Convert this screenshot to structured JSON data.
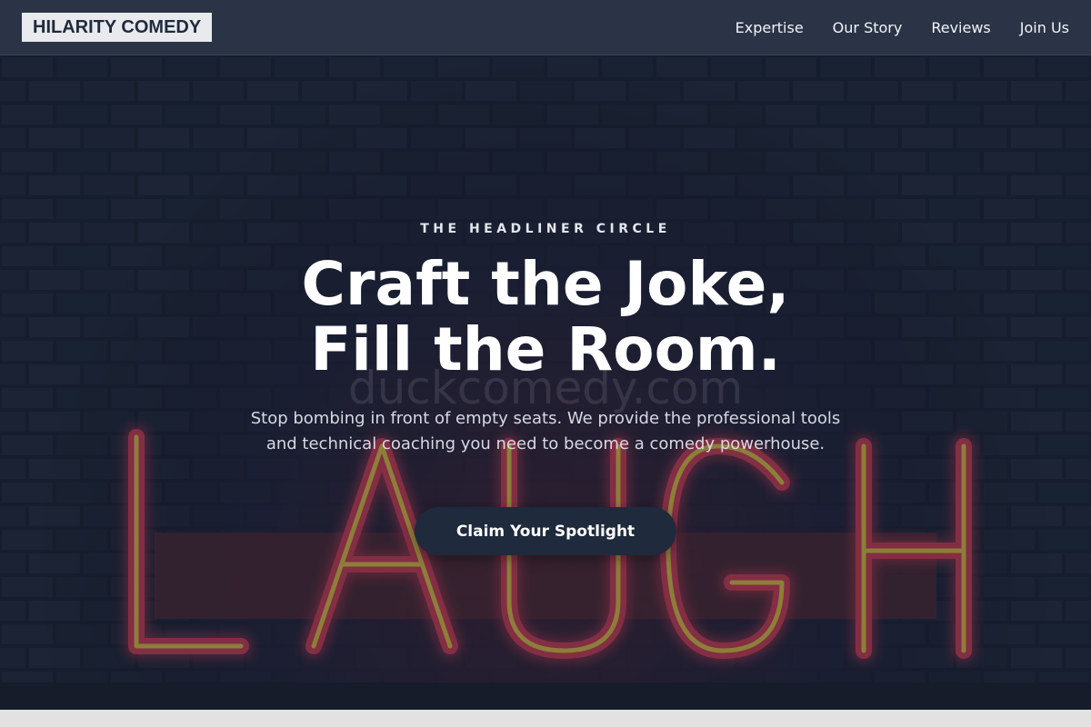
{
  "brand": {
    "logo_text": "HILARITY COMEDY"
  },
  "nav": {
    "links": [
      {
        "label": "Expertise"
      },
      {
        "label": "Our Story"
      },
      {
        "label": "Reviews"
      },
      {
        "label": "Join Us"
      }
    ]
  },
  "hero": {
    "eyebrow": "THE HEADLINER CIRCLE",
    "headline_line1": "Craft the Joke,",
    "headline_line2": "Fill the Room.",
    "subtext": "Stop bombing in front of empty seats. We provide the professional tools and technical coaching you need to become a comedy powerhouse.",
    "cta_label": "Claim Your Spotlight",
    "background_sign_text": "LAUGH",
    "watermark": "duckcomedy.com"
  },
  "colors": {
    "navbar": "#2a3446",
    "logo_bg": "#e8eaee",
    "cta_bg": "#1f2a3c",
    "neon_pink": "#e0405a",
    "neon_yellow": "#f2d24a"
  }
}
